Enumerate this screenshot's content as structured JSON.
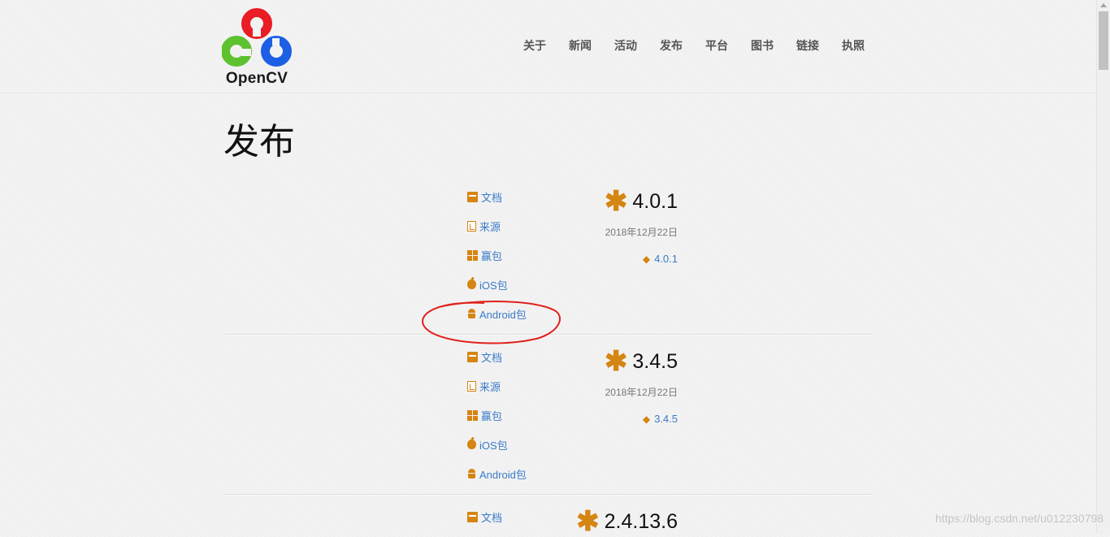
{
  "brand": {
    "logo_text": "OpenCV"
  },
  "nav": [
    "关于",
    "新闻",
    "活动",
    "发布",
    "平台",
    "图书",
    "链接",
    "执照"
  ],
  "page_title": "发布",
  "releases": [
    {
      "version": "4.0.1",
      "date": "2018年12月22日",
      "tag": "4.0.1",
      "links": [
        {
          "label": "文档",
          "icon": "archive-icon"
        },
        {
          "label": "来源",
          "icon": "source-file-icon"
        },
        {
          "label": "赢包",
          "icon": "windows-icon"
        },
        {
          "label": "iOS包",
          "icon": "apple-icon"
        },
        {
          "label": "Android包",
          "icon": "android-icon"
        }
      ]
    },
    {
      "version": "3.4.5",
      "date": "2018年12月22日",
      "tag": "3.4.5",
      "links": [
        {
          "label": "文档",
          "icon": "archive-icon"
        },
        {
          "label": "来源",
          "icon": "source-file-icon"
        },
        {
          "label": "赢包",
          "icon": "windows-icon"
        },
        {
          "label": "iOS包",
          "icon": "apple-icon"
        },
        {
          "label": "Android包",
          "icon": "android-icon"
        }
      ]
    },
    {
      "version": "2.4.13.6",
      "links": [
        {
          "label": "文档",
          "icon": "archive-icon"
        }
      ]
    }
  ],
  "watermark": "https://blog.csdn.net/u012230798",
  "colors": {
    "accent": "#d58512",
    "link": "#3a7bc8",
    "annotation": "#e0201b"
  }
}
